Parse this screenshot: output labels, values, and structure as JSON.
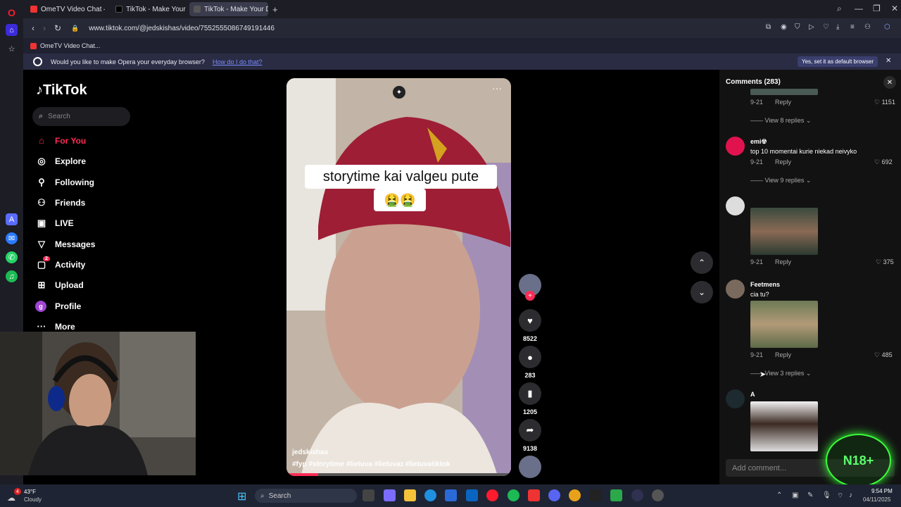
{
  "browser": {
    "tabs": [
      {
        "label": "OmeTV Video Chat — On"
      },
      {
        "label": "TikTok - Make Your Day"
      },
      {
        "label": "TikTok - Make Your Da"
      }
    ],
    "url": "www.tiktok.com/@jedskishas/video/7552555086749191446",
    "bookmark": "OmeTV Video Chat...",
    "default_prompt": "Would you like to make Opera your everyday browser?",
    "default_link": "How do I do that?",
    "default_button": "Yes, set it as default browser"
  },
  "tiktok": {
    "logo": "TikTok",
    "search_placeholder": "Search",
    "nav": [
      {
        "label": "For You",
        "icon": "home-icon"
      },
      {
        "label": "Explore",
        "icon": "compass-icon"
      },
      {
        "label": "Following",
        "icon": "following-icon"
      },
      {
        "label": "Friends",
        "icon": "friends-icon"
      },
      {
        "label": "LIVE",
        "icon": "live-icon"
      },
      {
        "label": "Messages",
        "icon": "messages-icon"
      },
      {
        "label": "Activity",
        "icon": "activity-icon",
        "badge": "2"
      },
      {
        "label": "Upload",
        "icon": "upload-icon"
      },
      {
        "label": "Profile",
        "icon": "profile-icon",
        "avatar_letter": "g"
      },
      {
        "label": "More",
        "icon": "more-icon"
      }
    ]
  },
  "video": {
    "caption_line1": "storytime kai valgeu pute",
    "caption_line2": "🤮🤮",
    "author": "jedskishas",
    "hashtags": "#fyp #storytime #lietuva #lietuvaɪ #lietuvatiktok",
    "likes": "8522",
    "comments": "283",
    "saves": "1205",
    "shares": "9138"
  },
  "comments_panel": {
    "title": "Comments (283)",
    "input_placeholder": "Add comment...",
    "items": [
      {
        "name": "",
        "text": "",
        "date": "9-21",
        "reply": "Reply",
        "likes": "1151",
        "view_replies": "View 8 replies"
      },
      {
        "name": "emi☢",
        "text": "top 10 momentai kurie niekad neivyko",
        "date": "9-21",
        "reply": "Reply",
        "likes": "692",
        "view_replies": "View 9 replies"
      },
      {
        "name": "",
        "text": "",
        "date": "9-21",
        "reply": "Reply",
        "likes": "375"
      },
      {
        "name": "Feetmens",
        "text": "cia tu?",
        "date": "9-21",
        "reply": "Reply",
        "likes": "485",
        "view_replies": "View 3 replies"
      },
      {
        "name": "A",
        "text": ""
      }
    ]
  },
  "overlay_badge": "N18+",
  "taskbar": {
    "weather_temp": "43°F",
    "weather_desc": "Cloudy",
    "weather_badge": "4",
    "search_placeholder": "Search",
    "time": "9:54 PM",
    "date": "04/11/2025"
  },
  "colors": {
    "tiktok_red": "#fe2c55",
    "opera_red": "#ff1b2d",
    "accent_blue": "#7a8cff"
  }
}
